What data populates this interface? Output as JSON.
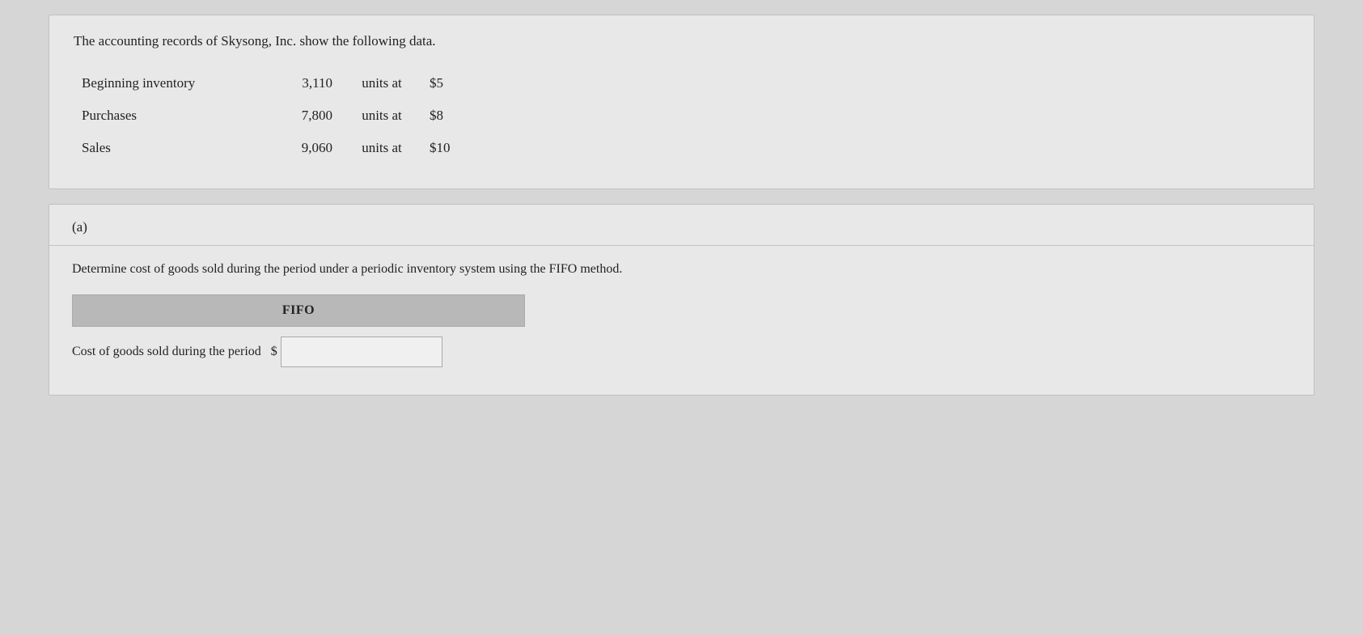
{
  "page": {
    "background": "#d6d6d6"
  },
  "top_card": {
    "intro_text": "The accounting records of Skysong, Inc. show the following data.",
    "rows": [
      {
        "label": "Beginning inventory",
        "quantity": "3,110",
        "units_text": "units at",
        "price": "$5"
      },
      {
        "label": "Purchases",
        "quantity": "7,800",
        "units_text": "units at",
        "price": "$8"
      },
      {
        "label": "Sales",
        "quantity": "9,060",
        "units_text": "units at",
        "price": "$10"
      }
    ]
  },
  "section_a": {
    "label": "(a)",
    "description": "Determine cost of goods sold during the period under a periodic inventory system using the FIFO method.",
    "fifo_header": "FIFO",
    "cogs_label": "Cost of goods sold during the period",
    "dollar_sign": "$",
    "input_placeholder": ""
  }
}
